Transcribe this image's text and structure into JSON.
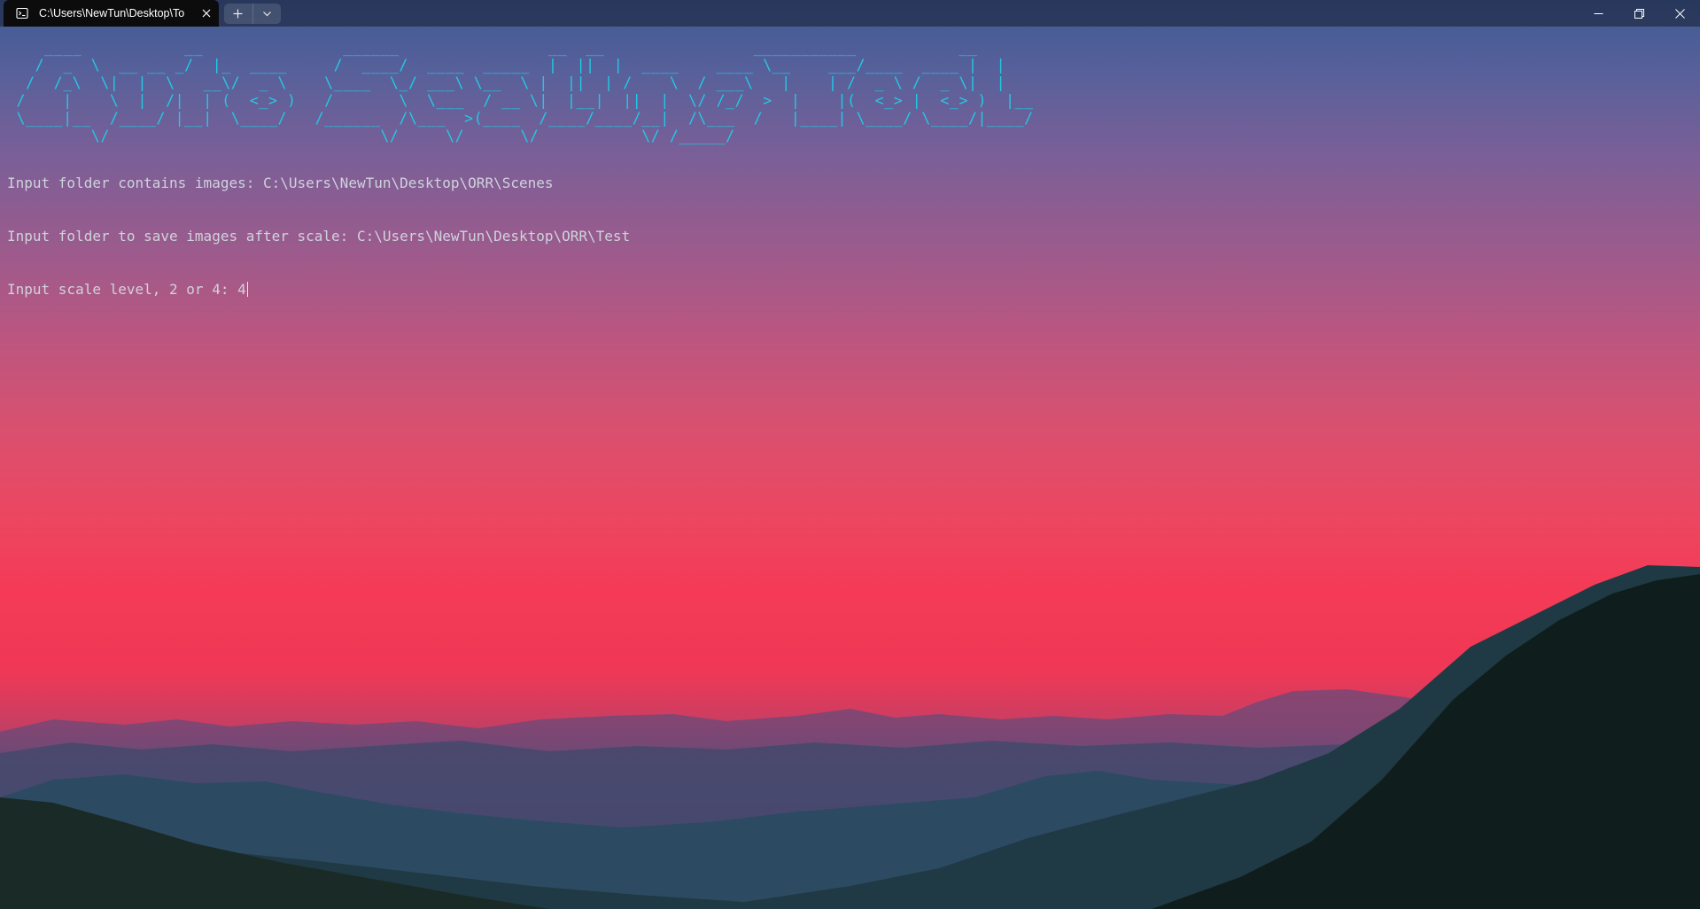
{
  "window": {
    "tab_title": "C:\\Users\\NewTun\\Desktop\\To",
    "tab_icon": "terminal-icon",
    "new_tab_icon": "plus-icon",
    "dropdown_icon": "chevron-down-icon",
    "minimize_icon": "minimize-icon",
    "maximize_icon": "restore-icon",
    "close_icon": "close-icon"
  },
  "terminal": {
    "banner_ascii": "    ____           __               ______                __  __                ___________           __ \n   /  _  \\  __ __ _/  |_  ____     /  ____/  ____  _____  |  ||  |  ____    ____ \\__    ___/____  ____ |  |\n  /  /_\\  \\|  |  \\   __\\/  _ \\    \\____  \\_/ ___\\ \\__  \\ |  ||  | /    \\  / ___\\   |    | /  _ \\ /  _ \\|  |\n /    |    \\  |  /|  | (  <_> )   /       \\  \\___  / __ \\|  |__|  ||  |  \\/ /_/  >  |    |(  <_> |  <_> )  |__\n \\____|__  /____/ |__|  \\____/   /______  /\\___  >(____  /____/____/__|  /\\___  /   |____| \\____/ \\____/|____/\n         \\/                             \\/     \\/      \\/           \\/ /_____/",
    "lines": [
      "Input folder contains images: C:\\Users\\NewTun\\Desktop\\ORR\\Scenes",
      "Input folder to save images after scale: C:\\Users\\NewTun\\Desktop\\ORR\\Test",
      "Input scale level, 2 or 4: 4"
    ],
    "banner_color": "#22c9e6",
    "text_color": "#cfd3dc"
  }
}
